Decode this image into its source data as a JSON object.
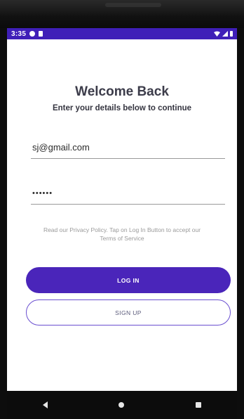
{
  "status_bar": {
    "time": "3:35"
  },
  "header": {
    "title": "Welcome Back",
    "subtitle": "Enter your details below to continue"
  },
  "form": {
    "email_value": "sj@gmail.com",
    "password_value": "••••••"
  },
  "policy_text": "Read our Privacy Policy. Tap on Log In Button to accept our Terms of Service",
  "buttons": {
    "login": "LOG IN",
    "signup": "SIGN UP"
  },
  "colors": {
    "primary": "#4a25ba",
    "status_bar": "#3f1fb8",
    "outline": "#6a4fd0"
  },
  "icons": {
    "status_left": [
      "notification-icon",
      "sim-icon"
    ],
    "status_right": [
      "wifi-icon",
      "signal-icon",
      "battery-icon"
    ],
    "nav": [
      "back-icon",
      "home-icon",
      "recents-icon"
    ]
  }
}
